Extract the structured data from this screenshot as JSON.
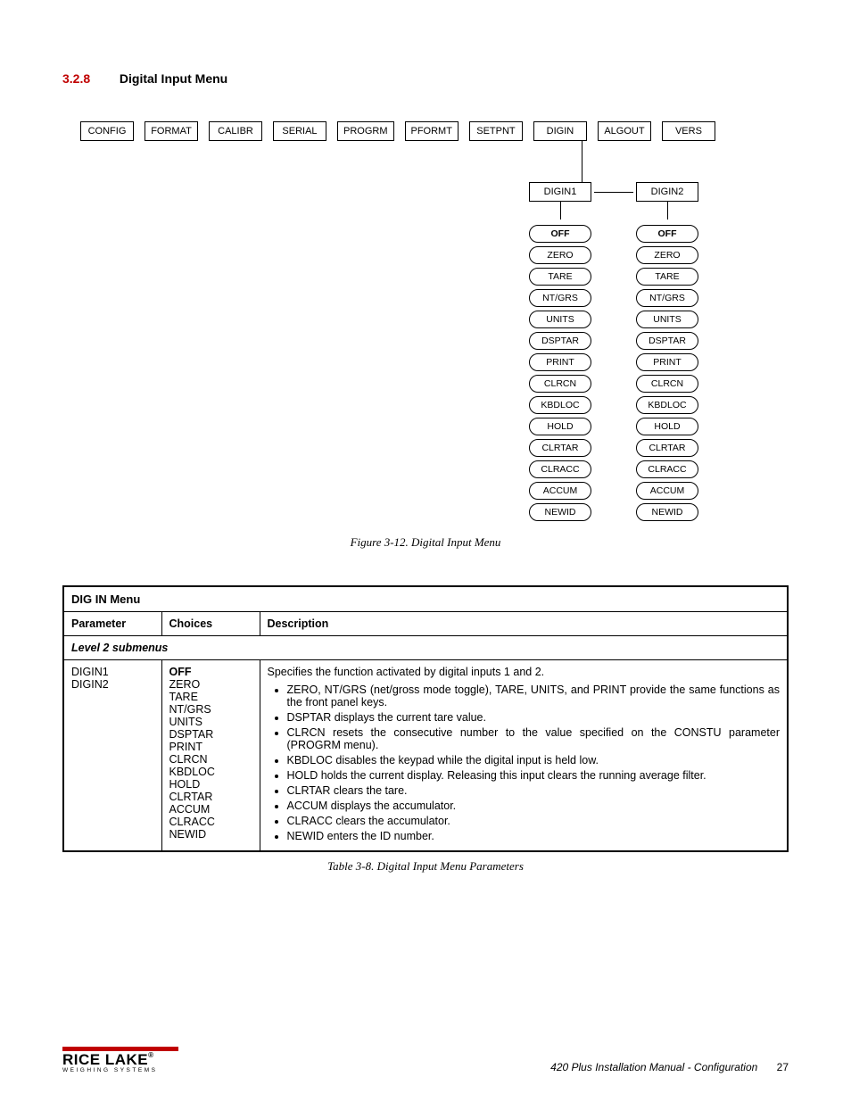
{
  "section": {
    "number": "3.2.8",
    "title": "Digital Input Menu"
  },
  "top_menu": [
    "CONFIG",
    "FORMAT",
    "CALIBR",
    "SERIAL",
    "PROGRM",
    "PFORMT",
    "SETPNT",
    "DIGIN",
    "ALGOUT",
    "VERS"
  ],
  "submenu_labels": {
    "d1": "DIGIN1",
    "d2": "DIGIN2"
  },
  "options": [
    "OFF",
    "ZERO",
    "TARE",
    "NT/GRS",
    "UNITS",
    "DSPTAR",
    "PRINT",
    "CLRCN",
    "KBDLOC",
    "HOLD",
    "CLRTAR",
    "CLRACC",
    "ACCUM",
    "NEWID"
  ],
  "figure_caption": "Figure 3-12. Digital Input Menu",
  "table": {
    "title": "DIG IN Menu",
    "headers": {
      "param": "Parameter",
      "choices": "Choices",
      "desc": "Description"
    },
    "level2": "Level 2 submenus",
    "row": {
      "params": [
        "DIGIN1",
        "DIGIN2"
      ],
      "choices_default": "OFF",
      "choices_rest": [
        "ZERO",
        "TARE",
        "NT/GRS",
        "UNITS",
        "DSPTAR",
        "PRINT",
        "CLRCN",
        "KBDLOC",
        "HOLD",
        "CLRTAR",
        "ACCUM",
        "CLRACC",
        "NEWID"
      ],
      "desc_intro": "Specifies the function activated by digital inputs 1 and 2.",
      "bullets": [
        "ZERO, NT/GRS (net/gross mode toggle), TARE, UNITS, and PRINT provide the same functions as the front panel keys.",
        "DSPTAR displays the current tare value.",
        "CLRCN resets the consecutive number to the value specified on the CONSTU parameter (PROGRM menu).",
        "KBDLOC disables the keypad while the digital input is held low.",
        "HOLD holds the current display. Releasing this input clears the running average filter.",
        "CLRTAR clears the tare.",
        "ACCUM displays the accumulator.",
        "CLRACC clears the accumulator.",
        "NEWID enters the ID number."
      ]
    }
  },
  "table_caption": "Table 3-8. Digital Input Menu Parameters",
  "footer": {
    "logo_name": "RICE LAKE",
    "logo_tag": "WEIGHING SYSTEMS",
    "doc": "420 Plus Installation Manual - Configuration",
    "page": "27"
  }
}
